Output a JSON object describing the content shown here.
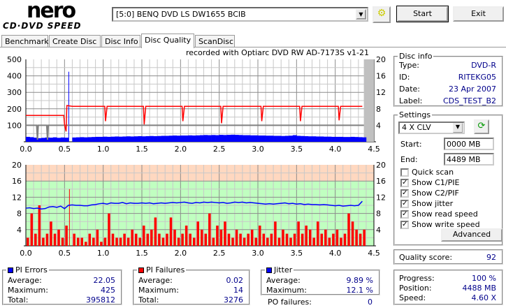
{
  "app": {
    "logo_top": "nero",
    "logo_bottom": "CD·DVD SPEED"
  },
  "toolbar": {
    "drive": "[5:0]  BENQ DVD LS DW1655 BCIB",
    "start": "Start",
    "exit": "Exit"
  },
  "tabs": [
    "Benchmark",
    "Create Disc",
    "Disc Info",
    "Disc Quality",
    "ScanDisc"
  ],
  "chart_title": "recorded with Optiarc DVD RW AD-7173S  v1-21",
  "disc_info": {
    "title": "Disc info",
    "rows": [
      {
        "label": "Type:",
        "value": "DVD-R"
      },
      {
        "label": "ID:",
        "value": "RITEKG05"
      },
      {
        "label": "Date:",
        "value": "23 Apr 2007"
      },
      {
        "label": "Label:",
        "value": "CDS_TEST_B2"
      }
    ]
  },
  "settings": {
    "title": "Settings",
    "speed": "4 X CLV",
    "start_label": "Start:",
    "start_value": "0000 MB",
    "end_label": "End:",
    "end_value": "4489 MB",
    "checks": [
      {
        "label": "Quick scan",
        "checked": false
      },
      {
        "label": "Show C1/PIE",
        "checked": true
      },
      {
        "label": "Show C2/PIF",
        "checked": true
      },
      {
        "label": "Show jitter",
        "checked": true
      },
      {
        "label": "Show read speed",
        "checked": true
      },
      {
        "label": "Show write speed",
        "checked": true
      }
    ],
    "advanced": "Advanced"
  },
  "quality": {
    "label": "Quality score:",
    "value": "92"
  },
  "progress": {
    "rows": [
      {
        "label": "Progress:",
        "value": "100 %"
      },
      {
        "label": "Position:",
        "value": "4488 MB"
      },
      {
        "label": "Speed:",
        "value": "4.60 X"
      }
    ]
  },
  "pi_errors": {
    "title": "PI Errors",
    "color": "#0000ff",
    "rows": [
      {
        "label": "Average:",
        "value": "22.05"
      },
      {
        "label": "Maximum:",
        "value": "425"
      },
      {
        "label": "Total:",
        "value": "395812"
      }
    ]
  },
  "pi_failures": {
    "title": "PI Failures",
    "color": "#ff0000",
    "rows": [
      {
        "label": "Average:",
        "value": "0.02"
      },
      {
        "label": "Maximum:",
        "value": "14"
      },
      {
        "label": "Total:",
        "value": "3276"
      }
    ]
  },
  "jitter": {
    "title": "Jitter",
    "color": "#0000ff",
    "rows": [
      {
        "label": "Average:",
        "value": "9.89 %"
      },
      {
        "label": "Maximum:",
        "value": "12.1 %"
      }
    ],
    "po_label": "PO failures:",
    "po_value": "0"
  },
  "chart_data": [
    {
      "type": "bar",
      "name": "PI errors / speed",
      "x_step": 0.05,
      "xlim": [
        0,
        4.5
      ],
      "ylim": [
        0,
        500
      ],
      "y2lim": [
        0,
        20
      ],
      "xticks": [
        "0.0",
        "0.5",
        "1.0",
        "1.5",
        "2.0",
        "2.5",
        "3.0",
        "3.5",
        "4.0",
        "4.5"
      ],
      "yticks": [
        "500",
        "400",
        "300",
        "200",
        "100"
      ],
      "y2ticks": [
        "20",
        "16",
        "12",
        "8",
        "4"
      ],
      "pie": [
        30,
        28,
        25,
        22,
        24,
        26,
        25,
        27,
        24,
        26,
        25,
        425,
        26,
        27,
        28,
        27,
        28,
        29,
        30,
        30,
        31,
        30,
        31,
        32,
        31,
        32,
        33,
        32,
        33,
        34,
        33,
        34,
        35,
        34,
        35,
        36,
        36,
        37,
        38,
        37,
        38,
        38,
        39,
        38,
        39,
        40,
        41,
        40,
        41,
        40,
        42,
        41,
        42,
        43,
        42,
        41,
        40,
        40,
        39,
        39,
        38,
        38,
        37,
        37,
        36,
        36,
        35,
        36,
        37,
        40,
        36,
        35,
        34,
        33,
        33,
        32,
        32,
        31,
        31,
        30,
        30,
        30,
        29,
        29,
        30,
        29,
        28,
        27
      ],
      "read_speed": [
        [
          0,
          6.4
        ],
        [
          0.49,
          6.4
        ],
        [
          0.5,
          4.2
        ],
        [
          0.52,
          2.5
        ],
        [
          0.53,
          8.8
        ],
        [
          0.6,
          8.6
        ],
        [
          1.02,
          8.6
        ],
        [
          1.03,
          5
        ],
        [
          1.05,
          8.6
        ],
        [
          1.52,
          8.6
        ],
        [
          1.53,
          4.2
        ],
        [
          1.55,
          8.6
        ],
        [
          2.02,
          8.6
        ],
        [
          2.03,
          5
        ],
        [
          2.05,
          8.6
        ],
        [
          2.52,
          8.6
        ],
        [
          2.53,
          4.5
        ],
        [
          2.55,
          8.6
        ],
        [
          3.04,
          8.6
        ],
        [
          3.05,
          5
        ],
        [
          3.07,
          8.6
        ],
        [
          3.54,
          8.6
        ],
        [
          3.55,
          5
        ],
        [
          3.57,
          8.6
        ],
        [
          4.04,
          8.6
        ],
        [
          4.05,
          5.2
        ],
        [
          4.07,
          8.6
        ],
        [
          4.35,
          8.6
        ]
      ],
      "write_speed": [
        [
          0,
          4
        ],
        [
          0.14,
          4
        ],
        [
          0.15,
          0.5
        ],
        [
          0.16,
          4
        ],
        [
          0.27,
          4
        ],
        [
          0.28,
          0.5
        ],
        [
          0.29,
          4
        ],
        [
          4.37,
          4
        ]
      ]
    },
    {
      "type": "bar",
      "name": "PI failures / jitter",
      "x_step": 0.05,
      "xlim": [
        0,
        4.5
      ],
      "ylim": [
        0,
        20
      ],
      "xticks": [
        "0.0",
        "0.5",
        "1.0",
        "1.5",
        "2.0",
        "2.5",
        "3.0",
        "3.5",
        "4.0",
        "4.5"
      ],
      "yticks": [
        "20",
        "16",
        "12",
        "8",
        "4"
      ],
      "y2ticks": [
        "20",
        "16",
        "12",
        "8",
        "4"
      ],
      "pif": [
        2,
        8,
        3,
        10,
        2,
        3,
        6,
        3,
        4,
        2,
        5,
        14,
        3,
        2,
        2,
        1,
        3,
        2,
        4,
        1,
        2,
        8,
        3,
        2,
        2,
        3,
        2,
        4,
        3,
        2,
        5,
        3,
        4,
        7,
        3,
        2,
        3,
        7,
        4,
        2,
        3,
        5,
        3,
        2,
        6,
        4,
        3,
        8,
        2,
        5,
        4,
        6,
        3,
        2,
        4,
        3,
        2,
        3,
        4,
        2,
        5,
        3,
        2,
        3,
        6,
        2,
        4,
        3,
        2,
        3,
        6,
        3,
        5,
        4,
        2,
        6,
        3,
        4,
        2,
        3,
        4,
        2,
        3,
        8,
        6,
        4,
        3,
        4
      ],
      "jitter": [
        9.3,
        9.4,
        9.2,
        9.3,
        9.1,
        9.2,
        9.6,
        9.7,
        9.5,
        9.8,
        9.2,
        10.0,
        10.1,
        10.0,
        10.0,
        9.9,
        9.9,
        10.1,
        10.2,
        10.4,
        10.5,
        10.3,
        10.6,
        10.5,
        10.5,
        10.7,
        10.4,
        10.6,
        10.5,
        10.5,
        10.6,
        10.5,
        10.6,
        10.4,
        10.5,
        10.6,
        10.5,
        10.6,
        10.7,
        10.6,
        10.7,
        10.8,
        10.6,
        10.5,
        10.7,
        10.6,
        10.8,
        10.7,
        10.8,
        10.7,
        10.6,
        10.7,
        10.5,
        10.6,
        10.8,
        10.7,
        10.8,
        10.6,
        10.7,
        10.6,
        10.5,
        10.4,
        10.3,
        10.4,
        10.3,
        10.4,
        10.5,
        10.6,
        10.4,
        10.5,
        10.3,
        10.4,
        10.2,
        10.3,
        10.2,
        10.2,
        10.1,
        10.2,
        10.1,
        10.0,
        9.9,
        10.0,
        9.8,
        9.9,
        10.0,
        9.9,
        10.0,
        11.0
      ],
      "zones": [
        {
          "from": 16,
          "to": 20,
          "color": "#ffd8c0"
        },
        {
          "from": 0,
          "to": 16,
          "color": "#c0ffc0"
        }
      ]
    }
  ]
}
